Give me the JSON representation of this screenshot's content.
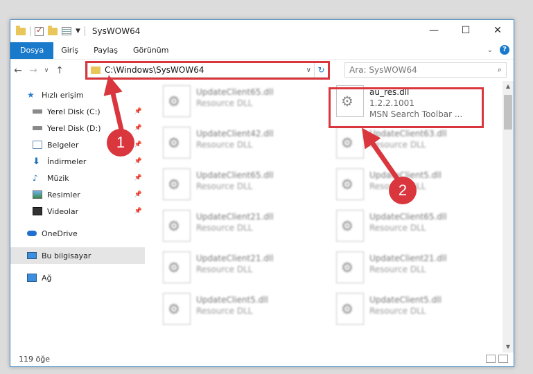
{
  "window": {
    "title": "SysWOW64"
  },
  "ribbon": {
    "tabs": [
      "Dosya",
      "Giriş",
      "Paylaş",
      "Görünüm"
    ]
  },
  "address": {
    "path": "C:\\Windows\\SysWOW64"
  },
  "search": {
    "placeholder": "Ara: SysWOW64"
  },
  "sidebar": {
    "items": [
      {
        "label": "Hızlı erişim",
        "icon": "star-icon"
      },
      {
        "label": "Yerel Disk (C:)",
        "icon": "drive-icon",
        "pinned": true
      },
      {
        "label": "Yerel Disk (D:)",
        "icon": "drive-icon",
        "pinned": true
      },
      {
        "label": "Belgeler",
        "icon": "documents-icon",
        "pinned": true
      },
      {
        "label": "İndirmeler",
        "icon": "download-icon",
        "pinned": true
      },
      {
        "label": "Müzik",
        "icon": "music-icon",
        "pinned": true
      },
      {
        "label": "Resimler",
        "icon": "pictures-icon",
        "pinned": true
      },
      {
        "label": "Videolar",
        "icon": "videos-icon",
        "pinned": true
      },
      {
        "label": "OneDrive",
        "icon": "cloud-icon"
      },
      {
        "label": "Bu bilgisayar",
        "icon": "computer-icon",
        "selected": true
      },
      {
        "label": "Ağ",
        "icon": "network-icon"
      }
    ]
  },
  "files": [
    {
      "name": "UpdateClient65.dll",
      "type": "Resource DLL"
    },
    {
      "name": "au_res.dll",
      "version": "1.2.2.1001",
      "type": "MSN Search Toolbar ..."
    },
    {
      "name": "UpdateClient42.dll",
      "type": "Resource DLL"
    },
    {
      "name": "UpdateClient63.dll",
      "type": "Resource DLL"
    },
    {
      "name": "UpdateClient65.dll",
      "type": "Resource DLL"
    },
    {
      "name": "UpdateClient5.dll",
      "type": "Resource DLL"
    },
    {
      "name": "UpdateClient21.dll",
      "type": "Resource DLL"
    },
    {
      "name": "UpdateClient65.dll",
      "type": "Resource DLL"
    },
    {
      "name": "UpdateClient21.dll",
      "type": "Resource DLL"
    },
    {
      "name": "UpdateClient21.dll",
      "type": "Resource DLL"
    },
    {
      "name": "UpdateClient5.dll",
      "type": "Resource DLL"
    },
    {
      "name": "UpdateClient5.dll",
      "type": "Resource DLL"
    }
  ],
  "status": {
    "count": "119 öğe"
  },
  "annotations": {
    "step1": "1",
    "step2": "2",
    "color": "#d9363e"
  }
}
